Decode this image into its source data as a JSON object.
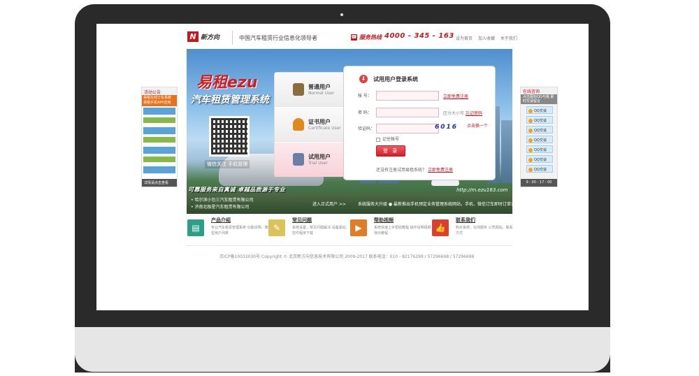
{
  "header": {
    "logo_mark": "N",
    "logo_text": "新方向",
    "slogan": "中国汽车租赁行业信息化领导者",
    "hotline_label": "服务热线",
    "hotline_number": "4000 - 345 - 163",
    "toplinks": [
      "设为首页",
      "加入收藏",
      "关于我们"
    ]
  },
  "banner": {
    "brand": "易租ezu",
    "system_name": "汽车租赁管理系统",
    "qr_caption": "微信关注 手机管理",
    "tagline": "可靠服务来自真诚 卓越品质源于专业",
    "news": [
      "哈尔滨小包三汽车租赁有限公司",
      "济南北极星汽车租赁有限公司"
    ],
    "trial_link": "进入正式用户 >>",
    "ticker": "系统服务大升级  ● 最新推出手机预定业务管理系统网站，手机、微信订车即时订单评价",
    "url": "http://m.ezu163.com"
  },
  "tabs": [
    {
      "cn": "普通用户",
      "en": "Normal User",
      "color": "#8a6d3b"
    },
    {
      "cn": "证书用户",
      "en": "Certificate User",
      "color": "#e08a1e"
    },
    {
      "cn": "试用用户",
      "en": "Trial User",
      "color": "#6a7fa8"
    }
  ],
  "login": {
    "title": "试用用户登录系统",
    "account_label": "帐  号：",
    "account_value": "",
    "account_hint": "立即免费注册",
    "password_label": "密  码：",
    "password_value": "",
    "password_hint_prefix": "区分大小写",
    "password_hint_link": "忘记密码",
    "captcha_label": "验证码：",
    "captcha_value": "",
    "captcha_text": "6016",
    "captcha_change": "点击换一个",
    "remember": "记住帐号",
    "button": "登 录",
    "footer_text": "还没有注册试用易租系统？",
    "footer_link": "立即免费注册"
  },
  "side_left": {
    "title": "活动公告",
    "ad": "易租在线订车系统 易租手机APP应用",
    "foot": "详情请点击查看"
  },
  "side_right": {
    "title": "在线咨询",
    "subtitle": "点击图标QQ与我 即时交谈留言",
    "qq_items": [
      "QQ交谈",
      "QQ交谈",
      "QQ交谈",
      "QQ交谈",
      "QQ交谈",
      "QQ交谈",
      "QQ交谈"
    ],
    "hours": "9 : 00 - 17 : 00"
  },
  "features": [
    {
      "title": "产品介绍",
      "desc": "专业汽车租赁管理系统 功能说明，典型用户列表",
      "color": "#2e9e86",
      "icon": "▤"
    },
    {
      "title": "常见问题",
      "desc": "系统设置，常见问题解决 设备驱动，控件程序下载",
      "color": "#d9c35a",
      "icon": "✎"
    },
    {
      "title": "帮助视频",
      "desc": "系统快速上手帮助教程 操作说明视频演示教程",
      "color": "#e07b2a",
      "icon": "▶"
    },
    {
      "title": "联系我们",
      "desc": "购买系统，在线服务 公司网站，联系方式",
      "color": "#d9402f",
      "icon": "👍"
    }
  ],
  "footer": "京ICP备10032030号  Copyright © 北京新方向信息技术有限公司  2009-2017  联系电话：010 - 82176299 / 57296698 / 57296696"
}
